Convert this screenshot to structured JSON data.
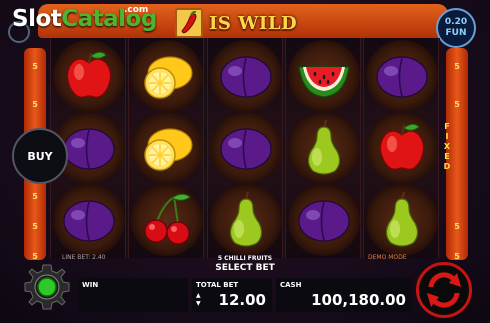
{
  "header": {
    "logo_slot": "Slot",
    "logo_catalog": "Catalog",
    "logo_com": ".com",
    "wild_text": "IS WILD",
    "bet_per_line": "0.20",
    "bet_currency": "FUN"
  },
  "side_lines": {
    "left": [
      "5",
      "5",
      "5",
      "5",
      "5",
      "5",
      "5"
    ],
    "right": [
      "5",
      "5",
      "5",
      "5",
      "5",
      "5",
      "5"
    ],
    "fixed_label": "FIXED"
  },
  "reels": [
    [
      "apple-icon",
      "plum-icon",
      "plum-icon"
    ],
    [
      "lemon-icon",
      "lemon-icon",
      "cherry-icon"
    ],
    [
      "plum-icon",
      "plum-icon",
      "pear-icon"
    ],
    [
      "watermelon-icon",
      "pear-icon",
      "plum-icon"
    ],
    [
      "plum-icon",
      "apple-icon",
      "pear-icon"
    ]
  ],
  "info": {
    "line_bet": "LINE BET: 2.40",
    "game_name": "5 CHILLI FRUITS",
    "mode": "DEMO MODE",
    "select_bet": "SELECT BET"
  },
  "controls": {
    "buy_label": "BUY",
    "win_label": "WIN",
    "win_value": "",
    "total_bet_label": "TOTAL BET",
    "total_bet_value": "12.00",
    "cash_label": "CASH",
    "cash_value": "100,180.00"
  }
}
